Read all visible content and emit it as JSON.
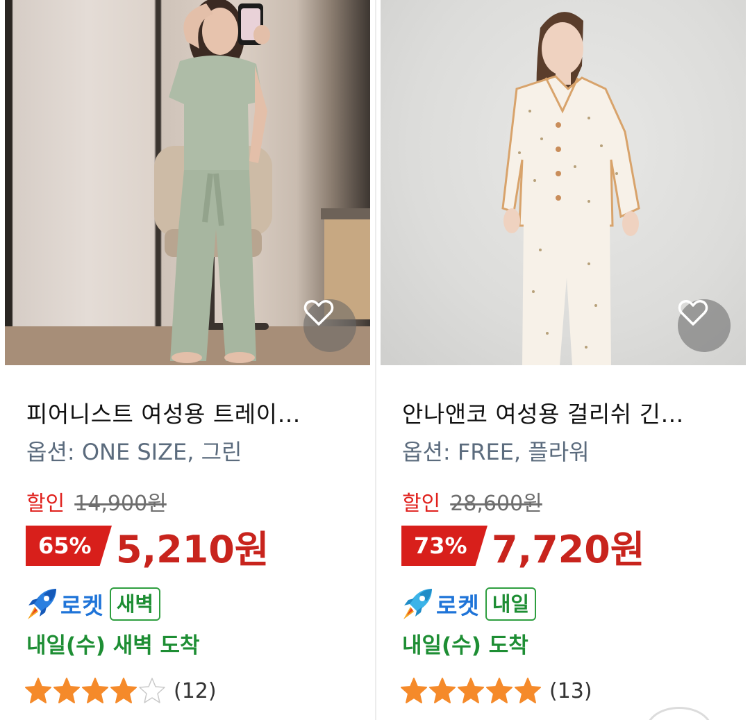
{
  "products": [
    {
      "title": "피어니스트 여성용 트레이…",
      "option": "옵션: ONE SIZE, 그린",
      "sale_label": "할인",
      "original_price": "14,900원",
      "discount": "65%",
      "price": "5,210원",
      "rocket_label": "로켓",
      "rocket_tag": "새벽",
      "arrival": "내일(수) 새벽 도착",
      "rating": 4,
      "review_count": "(12)",
      "wishlisted": false
    },
    {
      "title": "안나앤코 여성용 걸리쉬 긴…",
      "option": "옵션: FREE, 플라워",
      "sale_label": "할인",
      "original_price": "28,600원",
      "discount": "73%",
      "price": "7,720원",
      "rocket_label": "로켓",
      "rocket_tag": "내일",
      "arrival": "내일(수) 도착",
      "rating": 5,
      "review_count": "(13)",
      "wishlisted": false
    }
  ],
  "colors": {
    "sale_red": "#e0201c",
    "price_red": "#c8241d",
    "badge_red": "#d81f1b",
    "rocket_blue": "#1f74d8",
    "delivery_green": "#1e8e34",
    "star_orange": "#f58a2a",
    "option_gray": "#5b6b7d"
  },
  "icons": {
    "wishlist": "heart-outline-icon",
    "rocket": "rocket-icon",
    "star_filled": "star-filled-icon",
    "star_empty": "star-empty-icon"
  }
}
